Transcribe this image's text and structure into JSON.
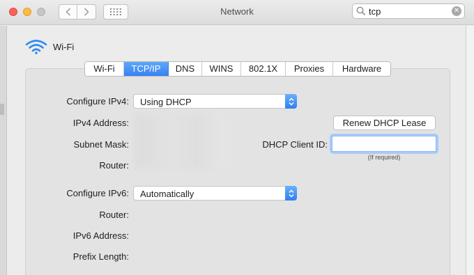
{
  "window": {
    "title": "Network"
  },
  "search": {
    "query": "tcp"
  },
  "service": {
    "name": "Wi-Fi"
  },
  "tabs": [
    {
      "label": "Wi-Fi",
      "active": false
    },
    {
      "label": "TCP/IP",
      "active": true
    },
    {
      "label": "DNS",
      "active": false
    },
    {
      "label": "WINS",
      "active": false
    },
    {
      "label": "802.1X",
      "active": false
    },
    {
      "label": "Proxies",
      "active": false
    },
    {
      "label": "Hardware",
      "active": false
    }
  ],
  "ipv4": {
    "configure_label": "Configure IPv4:",
    "configure_value": "Using DHCP",
    "address_label": "IPv4 Address:",
    "subnet_label": "Subnet Mask:",
    "router_label": "Router:"
  },
  "dhcp": {
    "renew_label": "Renew DHCP Lease",
    "client_id_label": "DHCP Client ID:",
    "client_id_value": "",
    "client_id_hint": "(If required)"
  },
  "ipv6": {
    "configure_label": "Configure IPv6:",
    "configure_value": "Automatically",
    "router_label": "Router:",
    "address_label": "IPv6 Address:",
    "prefix_label": "Prefix Length:"
  },
  "colors": {
    "accent": "#3b86f4",
    "wifi_icon": "#2d8cf0",
    "close_light": "#fc605c",
    "minimize_light": "#fdbc40"
  }
}
